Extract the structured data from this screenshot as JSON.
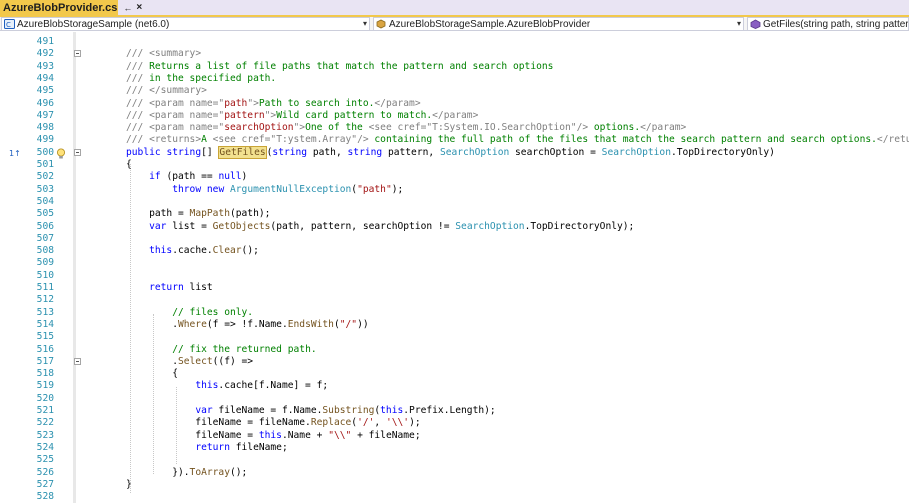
{
  "tab": {
    "title": "AzureBlobProvider.cs",
    "pin_glyph": "←",
    "close_glyph": "×"
  },
  "navbar": {
    "project": "AzureBlobStorageSample (net6.0)",
    "type": "AzureBlobStorageSample.AzureBlobProvider",
    "member": "GetFiles(string path, string pattern, Sear"
  },
  "editor": {
    "line_numbers": [
      "491",
      "492",
      "493",
      "494",
      "495",
      "496",
      "497",
      "498",
      "499",
      "500",
      "501",
      "502",
      "503",
      "504",
      "505",
      "506",
      "507",
      "508",
      "509",
      "510",
      "511",
      "512",
      "513",
      "514",
      "515",
      "516",
      "517",
      "518",
      "519",
      "520",
      "521",
      "522",
      "523",
      "524",
      "525",
      "526",
      "527",
      "528"
    ],
    "reference_marker": "1↑"
  },
  "colors": {
    "tab_active": "#f2c84b",
    "tab_strip": "#e9e4f3",
    "line_number": "#2b91af",
    "keyword": "#0000ff",
    "type": "#2b91af",
    "string": "#a31515",
    "comment": "#008000",
    "method": "#74531f",
    "xml_doc_tag": "#808080"
  },
  "icons": [
    "csharp-project-icon",
    "class-icon",
    "method-icon",
    "lightbulb-icon",
    "collapse-icon",
    "dropdown-arrow-icon"
  ]
}
